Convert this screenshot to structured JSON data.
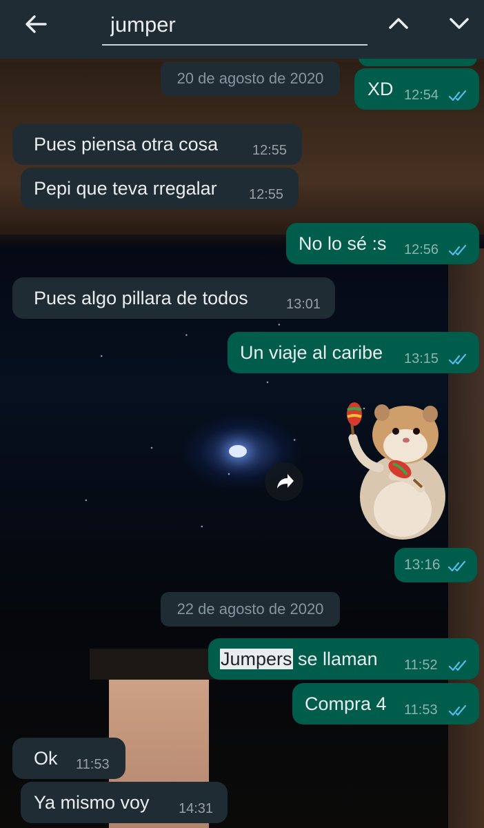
{
  "search": {
    "value": "jumper"
  },
  "colors": {
    "header": "#1f2c34",
    "incoming_bubble": "#1f2c34",
    "outgoing_bubble": "#005c4b",
    "read_ticks": "#53bdeb",
    "highlight": "#e9edef"
  },
  "icons": {
    "back": "arrow-left-icon",
    "prev": "chevron-up-icon",
    "next": "chevron-down-icon",
    "forward": "forward-arrow-icon",
    "read": "double-check-icon"
  },
  "dates": [
    "20 de agosto de 2020",
    "22 de agosto de 2020"
  ],
  "messages": [
    {
      "dir": "out",
      "text": "XD",
      "time": "12:54",
      "read": true
    },
    {
      "dir": "in",
      "text": "Pues piensa otra cosa",
      "time": "12:55"
    },
    {
      "dir": "in",
      "text": "Pepi que teva rregalar",
      "time": "12:55"
    },
    {
      "dir": "out",
      "text": "No lo sé :s",
      "time": "12:56",
      "read": true
    },
    {
      "dir": "in",
      "text": "Pues algo pillara de todos",
      "time": "13:01"
    },
    {
      "dir": "out",
      "text": "Un viaje al caribe",
      "time": "13:15",
      "read": true
    },
    {
      "dir": "out",
      "type": "sticker",
      "sticker": "hamster-with-maracas",
      "time": "13:16",
      "read": true
    },
    {
      "dir": "out",
      "highlight": "Jumpers",
      "text": " se llaman",
      "time": "11:52",
      "read": true
    },
    {
      "dir": "out",
      "text": "Compra 4",
      "time": "11:53",
      "read": true
    },
    {
      "dir": "in",
      "text": "Ok",
      "time": "11:53"
    },
    {
      "dir": "in",
      "text": "Ya mismo voy",
      "time": "14:31"
    }
  ]
}
